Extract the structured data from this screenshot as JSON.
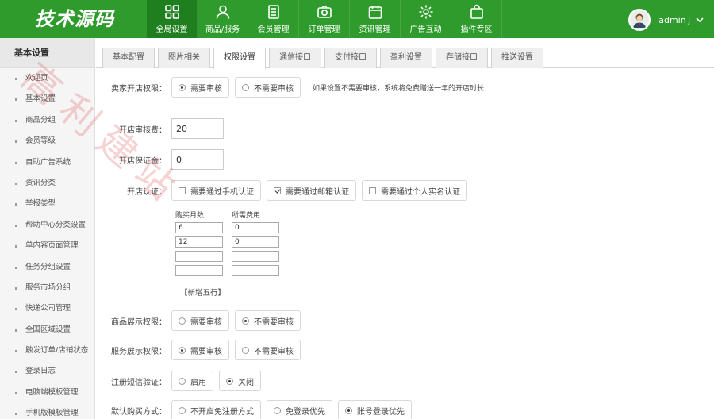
{
  "brand": {
    "logo_text": "技术源码"
  },
  "nav": [
    {
      "label": "全局设置",
      "icon": "grid-icon",
      "active": true
    },
    {
      "label": "商品/服务",
      "icon": "user-icon",
      "active": false
    },
    {
      "label": "会员管理",
      "icon": "list-icon",
      "active": false
    },
    {
      "label": "订单管理",
      "icon": "camera-icon",
      "active": false
    },
    {
      "label": "资讯管理",
      "icon": "calendar-icon",
      "active": false
    },
    {
      "label": "广告互动",
      "icon": "gear-icon",
      "active": false
    },
    {
      "label": "插件专区",
      "icon": "bag-icon",
      "active": false
    }
  ],
  "user": {
    "name": "admin",
    "icon": "chevron-down-icon"
  },
  "sidebar": {
    "title": "基本设置",
    "items": [
      {
        "label": "欢迎页"
      },
      {
        "label": "基本设置"
      },
      {
        "label": "商品分组"
      },
      {
        "label": "会员等级"
      },
      {
        "label": "自助广告系统"
      },
      {
        "label": "资讯分类"
      },
      {
        "label": "举报类型"
      },
      {
        "label": "帮助中心分类设置"
      },
      {
        "label": "单内容页面管理"
      },
      {
        "label": "任务分组设置"
      },
      {
        "label": "服务市场分组"
      },
      {
        "label": "快递公司管理"
      },
      {
        "label": "全国区域设置"
      },
      {
        "label": "触发订单/店铺状态"
      },
      {
        "label": "登录日志"
      },
      {
        "label": "电脑端模板管理"
      },
      {
        "label": "手机版模板管理"
      }
    ]
  },
  "tabs": [
    {
      "label": "基本配置",
      "active": false
    },
    {
      "label": "图片相关",
      "active": false
    },
    {
      "label": "权限设置",
      "active": true
    },
    {
      "label": "通信接口",
      "active": false
    },
    {
      "label": "支付接口",
      "active": false
    },
    {
      "label": "盈利设置",
      "active": false
    },
    {
      "label": "存储接口",
      "active": false
    },
    {
      "label": "推送设置",
      "active": false
    }
  ],
  "form": {
    "seller_permission": {
      "label": "卖家开店权限：",
      "options": [
        {
          "label": "需要审核",
          "checked": true
        },
        {
          "label": "不需要审核",
          "checked": false
        }
      ],
      "hint": "如果设置不需要审核，系统将免费赠送一年的开店时长"
    },
    "audit_fee": {
      "label": "开店审核费：",
      "value": "20"
    },
    "deposit": {
      "label": "开店保证金：",
      "value": "0"
    },
    "certification": {
      "label": "开店认证：",
      "options": [
        {
          "label": "需要通过手机认证",
          "checked": false
        },
        {
          "label": "需要通过邮箱认证",
          "checked": true
        },
        {
          "label": "需要通过个人实名认证",
          "checked": false
        }
      ]
    },
    "purchase_table": {
      "col1": "购买月数",
      "col2": "所需费用",
      "rows": [
        {
          "months": "6",
          "fee": "0"
        },
        {
          "months": "12",
          "fee": "0"
        },
        {
          "months": "",
          "fee": ""
        },
        {
          "months": "",
          "fee": ""
        }
      ],
      "add_label": "【新增五行】"
    },
    "goods_display": {
      "label": "商品展示权限：",
      "options": [
        {
          "label": "需要审核",
          "checked": false
        },
        {
          "label": "不需要审核",
          "checked": true
        }
      ]
    },
    "service_display": {
      "label": "服务展示权限：",
      "options": [
        {
          "label": "需要审核",
          "checked": true
        },
        {
          "label": "不需要审核",
          "checked": false
        }
      ]
    },
    "sms_verify": {
      "label": "注册短信验证：",
      "options": [
        {
          "label": "启用",
          "checked": false
        },
        {
          "label": "关闭",
          "checked": true
        }
      ]
    },
    "buy_mode": {
      "label": "默认购买方式：",
      "options": [
        {
          "label": "不开启免注册方式",
          "checked": false
        },
        {
          "label": "免登录优先",
          "checked": false
        },
        {
          "label": "账号登录优先",
          "checked": true
        }
      ]
    }
  },
  "watermark": {
    "text": "高利建站"
  },
  "colors": {
    "header": "#2e9b2c",
    "header_active": "#1f7e1d"
  }
}
